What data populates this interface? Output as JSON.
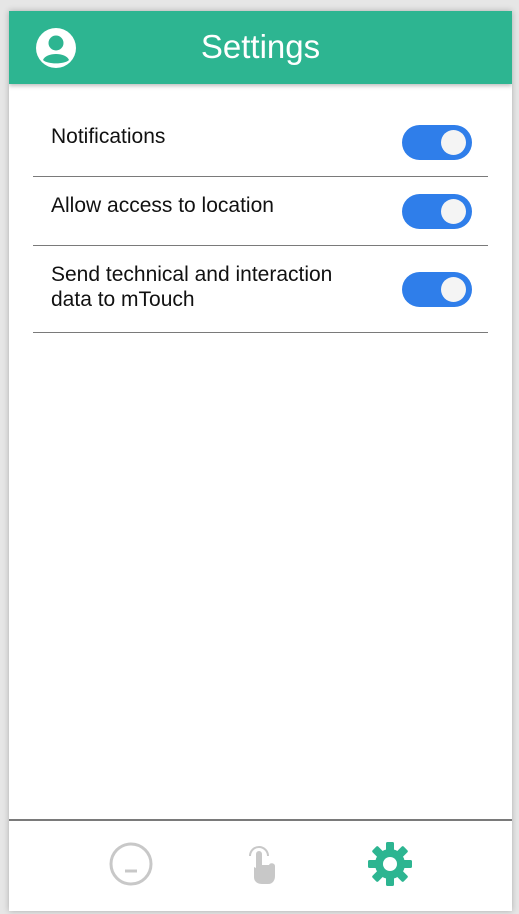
{
  "header": {
    "title": "Settings",
    "profile_icon": "account-circle-icon",
    "background_color": "#2db591"
  },
  "settings": [
    {
      "label": "Notifications",
      "enabled": true
    },
    {
      "label": "Allow access to location",
      "enabled": true
    },
    {
      "label": "Send technical and interaction data to mTouch",
      "enabled": true
    }
  ],
  "toggle": {
    "on_color": "#2f7eea"
  },
  "bottom_nav": {
    "items": [
      {
        "icon": "neutral-face-icon",
        "active": false
      },
      {
        "icon": "touch-hand-icon",
        "active": false
      },
      {
        "icon": "gear-icon",
        "active": true
      }
    ],
    "active_color": "#2db591",
    "inactive_color": "#c8c8c8"
  }
}
